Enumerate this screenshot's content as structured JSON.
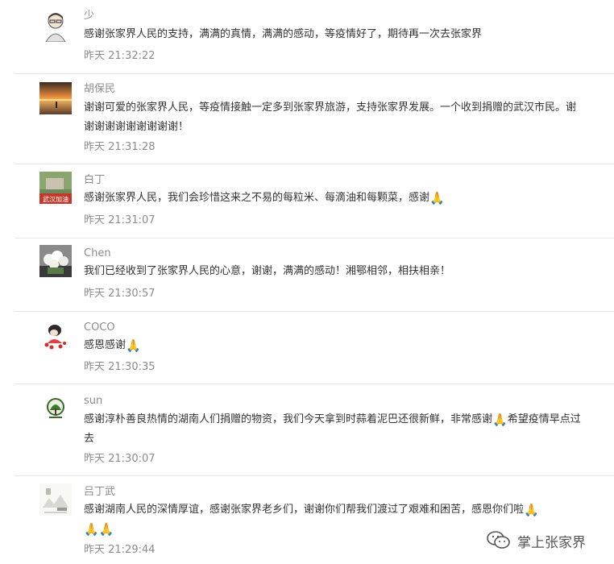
{
  "comments": [
    {
      "name": "少",
      "content": "感谢张家界人民的支持，满满的真情，满满的感动，等疫情好了，期待再一次去张家界",
      "time": "昨天 21:32:22"
    },
    {
      "name": "胡保民",
      "content": "谢谢可爱的张家界人民，等疫情接触一定多到张家界旅游，支持张家界发展。一个收到捐赠的武汉市民。谢谢谢谢谢谢谢谢谢谢！",
      "time": "昨天 21:31:28"
    },
    {
      "name": "白丁",
      "content": "感谢张家界人民，我们会珍惜这来之不易的每粒米、每滴油和每颗菜，感谢",
      "time": "昨天 21:31:07",
      "avatar_caption": "武汉加油"
    },
    {
      "name": "Chen",
      "content": "我们已经收到了张家界人民的心意，谢谢，满满的感动！湘鄂相邻，相扶相亲！",
      "time": "昨天 21:30:57"
    },
    {
      "name": "COCO",
      "content": "感恩感谢",
      "time": "昨天 21:30:35"
    },
    {
      "name": "sun",
      "content_part1": "感谢淳朴善良热情的湖南人们捐赠的物资，我们今天拿到时蒜着泥巴还很新鲜，非常感谢",
      "content_part2": "希望疫情早点过去",
      "time": "昨天 21:30:07"
    },
    {
      "name": "吕丁武",
      "content": "感谢湖南人民的深情厚谊，感谢张家界老乡们，谢谢你们帮我们渡过了艰难和困苦，感恩你们啦",
      "time": "昨天 21:29:44"
    }
  ],
  "emoji": {
    "pray": "🙏",
    "pray_name": "pray-hands-emoji"
  },
  "watermark": {
    "text": "掌上张家界"
  },
  "colors": {
    "name_gray": "#8c8c8c",
    "text": "#333333",
    "divider": "#e6e6e6"
  }
}
